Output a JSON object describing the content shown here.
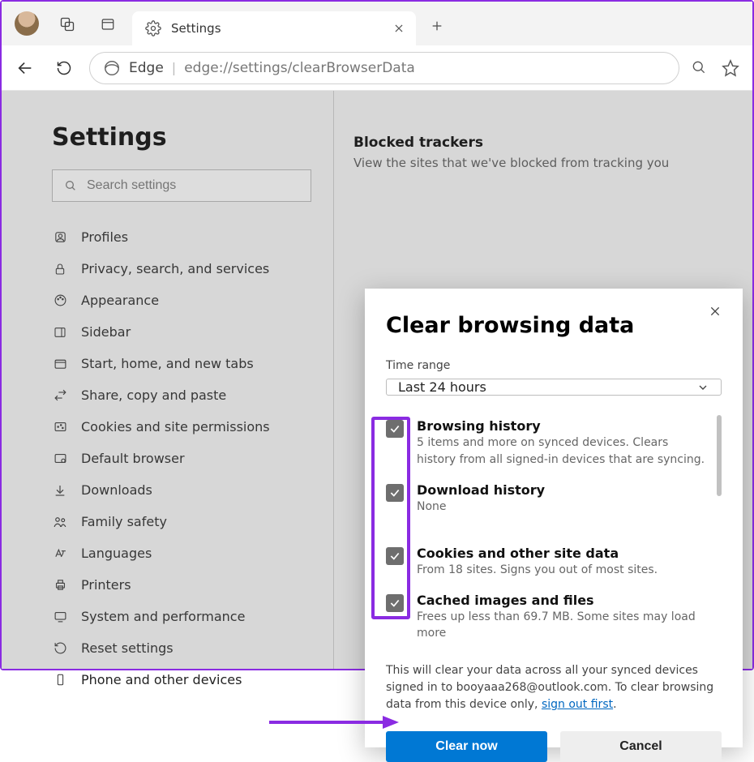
{
  "tab": {
    "title": "Settings"
  },
  "address": {
    "brand": "Edge",
    "url": "edge://settings/clearBrowserData"
  },
  "sidebar": {
    "title": "Settings",
    "search_placeholder": "Search settings",
    "items": [
      {
        "label": "Profiles"
      },
      {
        "label": "Privacy, search, and services"
      },
      {
        "label": "Appearance"
      },
      {
        "label": "Sidebar"
      },
      {
        "label": "Start, home, and new tabs"
      },
      {
        "label": "Share, copy and paste"
      },
      {
        "label": "Cookies and site permissions"
      },
      {
        "label": "Default browser"
      },
      {
        "label": "Downloads"
      },
      {
        "label": "Family safety"
      },
      {
        "label": "Languages"
      },
      {
        "label": "Printers"
      },
      {
        "label": "System and performance"
      },
      {
        "label": "Reset settings"
      },
      {
        "label": "Phone and other devices"
      }
    ]
  },
  "main_partial": {
    "blocked_title": "Blocked trackers",
    "blocked_desc": "View the sites that we've blocked from tracking you"
  },
  "dialog": {
    "title": "Clear browsing data",
    "time_range_label": "Time range",
    "time_range_value": "Last 24 hours",
    "items": [
      {
        "title": "Browsing history",
        "desc": "5 items and more on synced devices. Clears history from all signed-in devices that are syncing."
      },
      {
        "title": "Download history",
        "desc": "None"
      },
      {
        "title": "Cookies and other site data",
        "desc": "From 18 sites. Signs you out of most sites."
      },
      {
        "title": "Cached images and files",
        "desc": "Frees up less than 69.7 MB. Some sites may load more"
      }
    ],
    "note_pre": "This will clear your data across all your synced devices signed in to booyaaa268@outlook.com. To clear browsing data from this device only, ",
    "note_link": "sign out first",
    "clear_label": "Clear now",
    "cancel_label": "Cancel"
  }
}
